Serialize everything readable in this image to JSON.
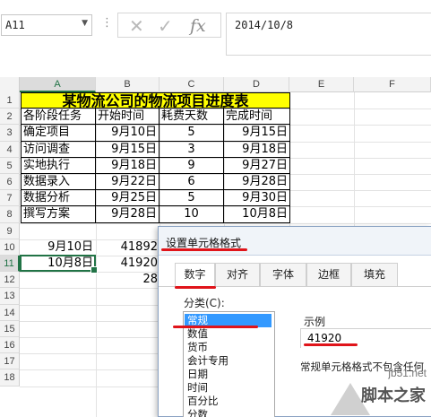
{
  "formula_bar": {
    "name_box": "A11",
    "cancel_icon": "✕",
    "enter_icon": "✓",
    "fx_label": "fx",
    "formula": "2014/10/8"
  },
  "columns": [
    "A",
    "B",
    "C",
    "D",
    "E",
    "F"
  ],
  "rows": [
    "1",
    "2",
    "3",
    "4",
    "5",
    "6",
    "7",
    "8",
    "9",
    "10",
    "11",
    "12",
    "13",
    "14",
    "15",
    "16",
    "17",
    "18"
  ],
  "selected_column": "A",
  "selected_row": "11",
  "table": {
    "title": "某物流公司的物流项目进度表",
    "headers": [
      "各阶段任务",
      "开始时间",
      "耗费天数",
      "完成时间"
    ],
    "rows": [
      [
        "确定项目",
        "9月10日",
        "5",
        "9月15日"
      ],
      [
        "访问调查",
        "9月15日",
        "3",
        "9月18日"
      ],
      [
        "实地执行",
        "9月18日",
        "9",
        "9月27日"
      ],
      [
        "数据录入",
        "9月22日",
        "6",
        "9月28日"
      ],
      [
        "数据分析",
        "9月25日",
        "5",
        "9月30日"
      ],
      [
        "撰写方案",
        "9月28日",
        "10",
        "10月8日"
      ]
    ]
  },
  "extra_cells": {
    "a10": "9月10日",
    "b10": "41892",
    "a11": "10月8日",
    "b11": "41920",
    "b12": "28"
  },
  "dialog": {
    "title": "设置单元格格式",
    "tabs": [
      "数字",
      "对齐",
      "字体",
      "边框",
      "填充"
    ],
    "active_tab": "数字",
    "category_label": "分类(C):",
    "categories": [
      "常规",
      "数值",
      "货币",
      "会计专用",
      "日期",
      "时间",
      "百分比",
      "分数"
    ],
    "selected_category": "常规",
    "sample_label": "示例",
    "sample_value": "41920",
    "description": "常规单元格格式不包含任何"
  },
  "watermark": {
    "url": "jb51.net",
    "site": "脚本之家"
  },
  "colors": {
    "title_fill": "#ffff00",
    "accent": "#217346",
    "annotation_red": "#e0141a",
    "selection_blue": "#3399ff"
  }
}
